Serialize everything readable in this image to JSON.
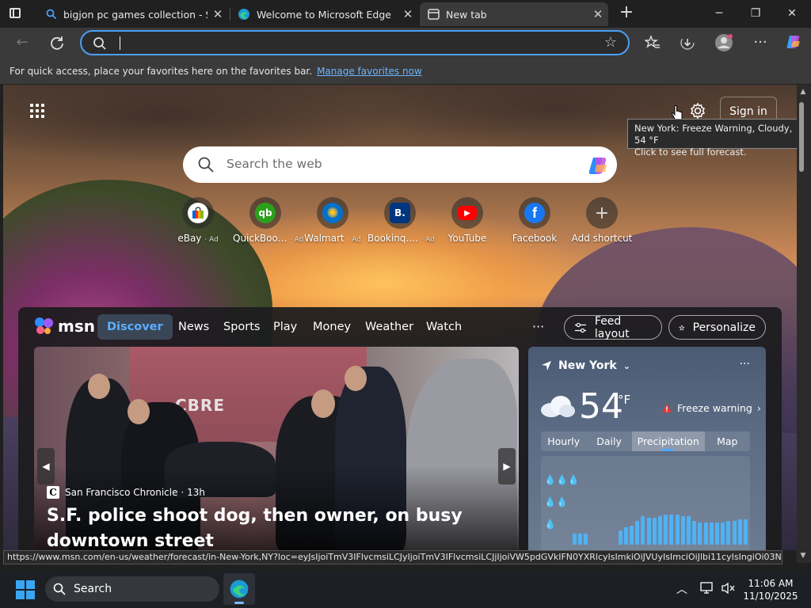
{
  "tabs": [
    {
      "title": "bigjon pc games collection - Sear",
      "state": "inactive",
      "icon": "bing-search-icon"
    },
    {
      "title": "Welcome to Microsoft Edge",
      "state": "inactive",
      "icon": "edge-icon"
    },
    {
      "title": "New tab",
      "state": "active",
      "icon": "new-tab-icon"
    }
  ],
  "address": {
    "value": "",
    "placeholder": ""
  },
  "favbar": {
    "hint": "For quick access, place your favorites here on the favorites bar.",
    "link": "Manage favorites now"
  },
  "ntp": {
    "signin": "Sign in",
    "tooltip_line1": "New York: Freeze Warning, Cloudy, 54 °F",
    "tooltip_line2": "Click to see full forecast.",
    "search_placeholder": "Search the web",
    "shortcuts": [
      {
        "label": "eBay",
        "ad": "· Ad",
        "color": "#ffffff",
        "glyph": "🛍",
        "icon": "ebay-icon"
      },
      {
        "label": "QuickBoo...",
        "ad": "· Ad",
        "color": "#2ca01c",
        "glyph": "qb",
        "icon": "quickbooks-icon"
      },
      {
        "label": "Walmart",
        "ad": "· Ad",
        "color": "#0071ce",
        "glyph": "✺",
        "icon": "walmart-icon"
      },
      {
        "label": "Bookinq....",
        "ad": "· Ad",
        "color": "#003580",
        "glyph": "B.",
        "icon": "booking-icon"
      },
      {
        "label": "YouTube",
        "ad": "",
        "color": "#ff0000",
        "glyph": "▶",
        "icon": "youtube-icon"
      },
      {
        "label": "Facebook",
        "ad": "",
        "color": "#1877f2",
        "glyph": "f",
        "icon": "facebook-icon"
      },
      {
        "label": "Add shortcut",
        "ad": "",
        "color": "transparent",
        "glyph": "+",
        "icon": "plus-icon"
      }
    ]
  },
  "feed": {
    "logo": "msn",
    "nav": [
      "Discover",
      "News",
      "Sports",
      "Play",
      "Money",
      "Weather",
      "Watch"
    ],
    "more": "···",
    "feed_layout": "Feed layout",
    "personalize": "Personalize",
    "hero": {
      "source": "San Francisco Chronicle",
      "time": "· 13h",
      "headline": "S.F. police shoot dog, then owner, on busy downtown street",
      "sign": "CBRE"
    },
    "weather": {
      "location": "New York",
      "temp": "54",
      "unit": "°F",
      "alert": "Freeze warning",
      "tabs": [
        "Hourly",
        "Daily",
        "Precipitation",
        "Map"
      ],
      "selected_tab": "Precipitation"
    }
  },
  "status_url": "https://www.msn.com/en-us/weather/forecast/in-New-York,NY?loc=eyJsIjoiTmV3IFlvcmsiLCJyIjoiTmV3IFlvcmsiLCJjIjoiVW5pdGVkIFN0YXRlcyIsImkiOiJVUyIsImciOiJlbi11cyIsIngiOi03NC4...",
  "taskbar": {
    "search": "Search",
    "time": "11:06 AM",
    "date": "11/10/2025"
  },
  "colors": {
    "accent": "#4a9ff5",
    "link": "#6db4ff",
    "discover_active": "#5aaeff"
  }
}
